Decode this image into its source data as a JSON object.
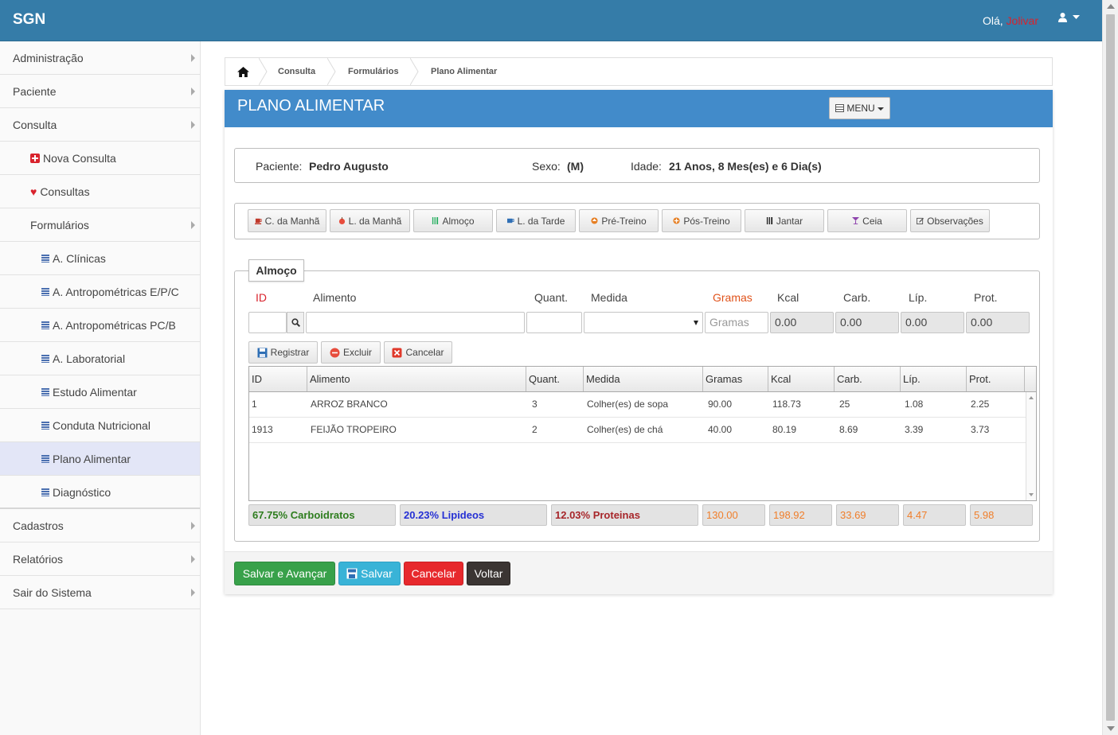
{
  "navbar": {
    "brand": "SGN",
    "greeting": "Olá,",
    "user": "Jolivar"
  },
  "sidebar": {
    "items": [
      {
        "label": "Administração"
      },
      {
        "label": "Paciente"
      },
      {
        "label": "Consulta"
      },
      {
        "label": "Nova Consulta"
      },
      {
        "label": "Consultas"
      },
      {
        "label": "Formulários"
      },
      {
        "label": "A. Clínicas"
      },
      {
        "label": "A. Antropométricas E/P/C"
      },
      {
        "label": "A. Antropométricas PC/B"
      },
      {
        "label": "A. Laboratorial"
      },
      {
        "label": "Estudo Alimentar"
      },
      {
        "label": "Conduta Nutricional"
      },
      {
        "label": "Plano Alimentar"
      },
      {
        "label": "Diagnóstico"
      },
      {
        "label": "Cadastros"
      },
      {
        "label": "Relatórios"
      },
      {
        "label": "Sair do Sistema"
      }
    ]
  },
  "breadcrumb": {
    "items": [
      "Consulta",
      "Formulários",
      "Plano Alimentar"
    ]
  },
  "panel": {
    "title": "PLANO ALIMENTAR",
    "menu_label": "MENU"
  },
  "patient": {
    "name_label": "Paciente:",
    "name": "Pedro Augusto",
    "sex_label": "Sexo:",
    "sex": "(M)",
    "age_label": "Idade:",
    "age": "21 Anos, 8 Mes(es) e 6 Dia(s)"
  },
  "meals": [
    "C. da Manhã",
    "L. da Manhã",
    "Almoço",
    "L. da Tarde",
    "Pré-Treino",
    "Pós-Treino",
    "Jantar",
    "Ceia",
    "Observações"
  ],
  "section": {
    "legend": "Almoço"
  },
  "form": {
    "labels": {
      "id": "ID",
      "alimento": "Alimento",
      "quant": "Quant.",
      "medida": "Medida",
      "gramas": "Gramas",
      "kcal": "Kcal",
      "carb": "Carb.",
      "lip": "Líp.",
      "prot": "Prot."
    },
    "gramas_placeholder": "Gramas",
    "kcal": "0.00",
    "carb": "0.00",
    "lip": "0.00",
    "prot": "0.00"
  },
  "actions": {
    "registrar": "Registrar",
    "excluir": "Excluir",
    "cancelar": "Cancelar"
  },
  "grid": {
    "headers": [
      "ID",
      "Alimento",
      "Quant.",
      "Medida",
      "Gramas",
      "Kcal",
      "Carb.",
      "Líp.",
      "Prot."
    ],
    "rows": [
      [
        "1",
        "ARROZ BRANCO",
        "3",
        "Colher(es) de sopa",
        "90.00",
        "118.73",
        "25",
        "1.08",
        "2.25"
      ],
      [
        "1913",
        "FEIJÃO TROPEIRO",
        "2",
        "Colher(es) de chá",
        "40.00",
        "80.19",
        "8.69",
        "3.39",
        "3.73"
      ]
    ]
  },
  "totals": {
    "carb_pct": "67.75% Carboidratos",
    "lip_pct": "20.23% Lipideos",
    "prot_pct": "12.03% Proteinas",
    "gramas": "130.00",
    "kcal": "198.92",
    "carb": "33.69",
    "lip": "4.47",
    "prot": "5.98"
  },
  "footer": {
    "save_next": "Salvar e Avançar",
    "save": "Salvar",
    "cancel": "Cancelar",
    "back": "Voltar"
  }
}
